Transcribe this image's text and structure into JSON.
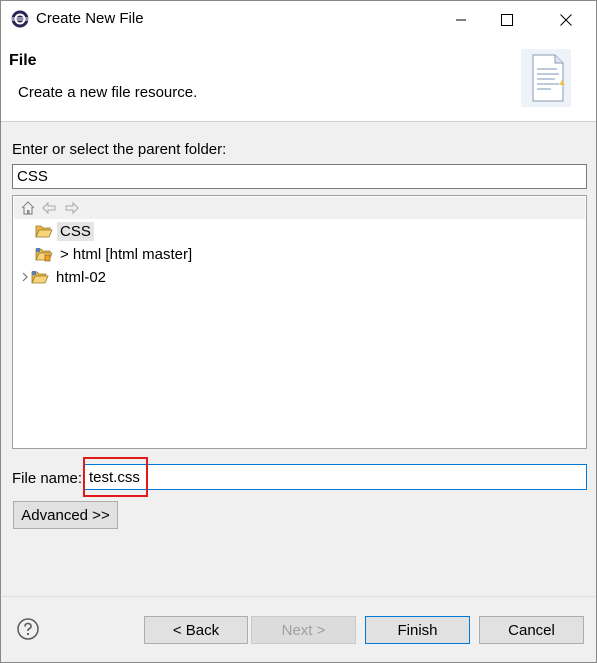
{
  "window": {
    "title": "Create New File",
    "icons": {
      "app": "eclipse-icon",
      "minimize": "minimize-icon",
      "maximize": "maximize-icon",
      "close": "close-icon"
    }
  },
  "banner": {
    "title": "File",
    "description": "Create a new file resource.",
    "icon": "new-file-wizard-icon"
  },
  "parent_folder": {
    "label": "Enter or select the parent folder:",
    "value": "CSS"
  },
  "tree": {
    "toolbar_icons": [
      "home-icon",
      "back-arrow-icon",
      "forward-arrow-icon"
    ],
    "items": [
      {
        "label": "CSS",
        "icon": "open-folder-icon",
        "selected": true,
        "expandable": false
      },
      {
        "label": "> html [html master]",
        "icon": "git-project-folder-icon",
        "selected": false,
        "expandable": false
      },
      {
        "label": "html-02",
        "icon": "project-folder-icon",
        "selected": false,
        "expandable": true
      }
    ]
  },
  "file_name": {
    "label": "File name:",
    "value": "test.css"
  },
  "buttons": {
    "advanced": "Advanced >>",
    "back": "< Back",
    "next": "Next >",
    "finish": "Finish",
    "cancel": "Cancel"
  },
  "help_icon": "help-icon",
  "colors": {
    "highlight_box": "#e11a1a",
    "focus_border": "#0078d7"
  }
}
